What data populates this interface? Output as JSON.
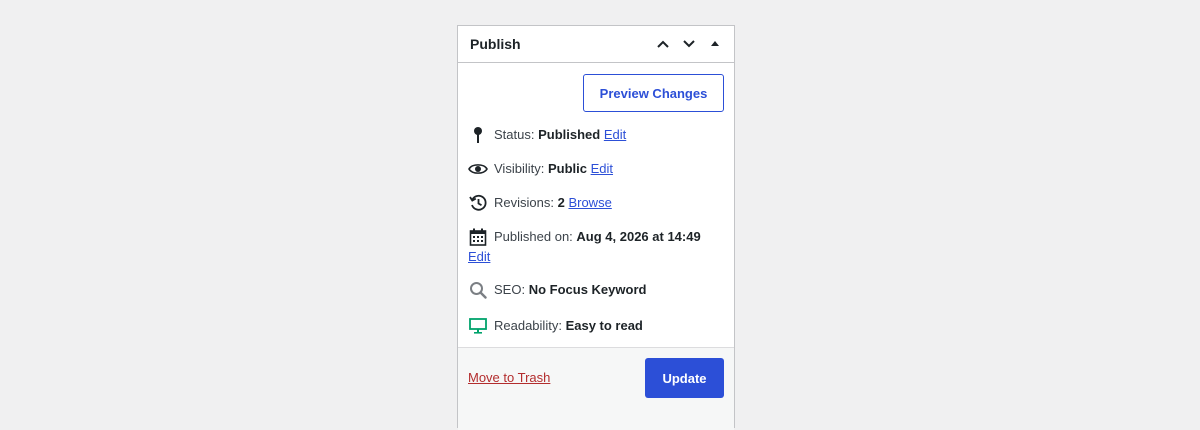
{
  "panel": {
    "title": "Publish",
    "controls": {
      "move_up": "chevron-up-icon",
      "move_down": "chevron-down-icon",
      "toggle": "caret-up-icon"
    }
  },
  "actions": {
    "preview_label": "Preview Changes"
  },
  "status": {
    "label": "Status:",
    "value": "Published",
    "link": "Edit",
    "icon": "pin-icon"
  },
  "visibility": {
    "label": "Visibility:",
    "value": "Public",
    "link": "Edit",
    "icon": "eye-icon"
  },
  "revisions": {
    "label": "Revisions:",
    "value": "2",
    "link": "Browse",
    "icon": "history-icon"
  },
  "published": {
    "label": "Published on:",
    "value": "Aug 4, 2026 at 14:49",
    "link": "Edit",
    "icon": "calendar-icon"
  },
  "seo": {
    "label": "SEO:",
    "value": "No Focus Keyword",
    "icon": "search-icon"
  },
  "readability": {
    "label": "Readability:",
    "value": "Easy to read",
    "icon": "monitor-icon"
  },
  "footer": {
    "trash_label": "Move to Trash",
    "update_label": "Update"
  },
  "colors": {
    "accent": "#2c4fd7",
    "danger": "#b32d2e",
    "success": "#00a36c"
  }
}
